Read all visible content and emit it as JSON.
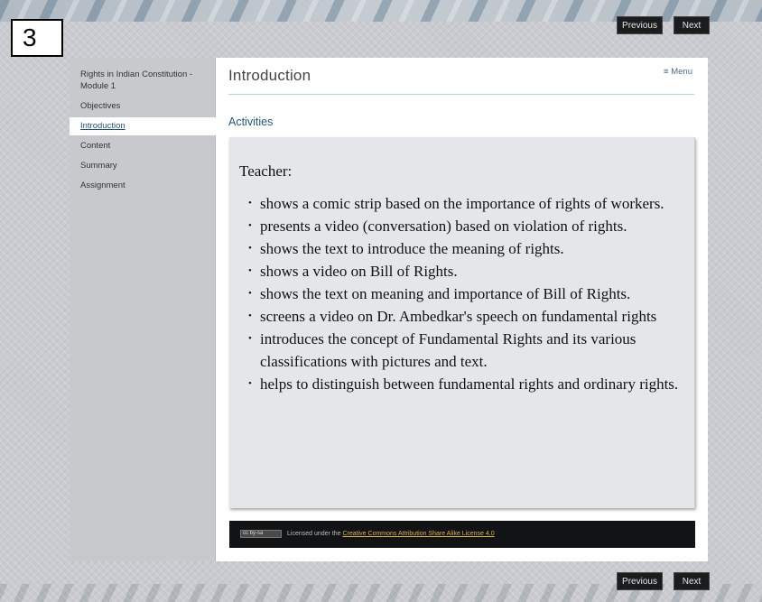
{
  "slide_number": "3",
  "nav": {
    "previous_label": "Previous",
    "next_label": "Next"
  },
  "sidebar": {
    "module_title": "Rights in Indian Constitution - Module 1",
    "items": [
      {
        "label": "Objectives",
        "active": false
      },
      {
        "label": "Introduction",
        "active": true
      },
      {
        "label": "Content",
        "active": false
      },
      {
        "label": "Summary",
        "active": false
      },
      {
        "label": "Assignment",
        "active": false
      }
    ]
  },
  "main": {
    "page_title": "Introduction",
    "menu_label": "Menu",
    "menu_icon": "hamburger-icon",
    "section_heading": "Activities",
    "activity_heading": "Teacher:",
    "activities": [
      "shows a comic strip based on the importance of rights of workers.",
      "presents a video (conversation) based on violation of rights.",
      "shows the text to introduce the meaning of rights.",
      "shows a video on Bill of Rights.",
      "shows the text on meaning and importance of Bill of Rights.",
      "screens a video on Dr. Ambedkar's speech on fundamental rights",
      "introduces the concept of Fundamental Rights and its various classifications with pictures and text.",
      "helps to distinguish between fundamental rights and ordinary rights."
    ]
  },
  "footer": {
    "badge_text": "cc by-sa",
    "license_prefix": "Licensed under the",
    "license_link": "Creative Commons Attribution Share Alike License 4.0"
  },
  "colors": {
    "accent": "#1f5678",
    "active_link": "#1f4e7a",
    "sidebar_bg": "#c7c9cc",
    "activity_bg": "#e4e6ea",
    "footer_bg": "#121314",
    "license_link": "#d9b24a"
  }
}
